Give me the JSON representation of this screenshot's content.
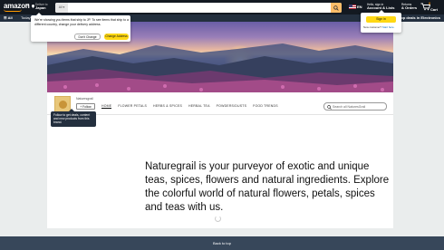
{
  "header": {
    "logo_text": "amazon",
    "logo_suffix": ".sg",
    "deliver_line1": "Deliver to",
    "deliver_line2": "Japan",
    "search_category": "All",
    "search_placeholder": "",
    "language": "EN",
    "account_line1": "Hello, sign in",
    "account_line2": "Account & Lists",
    "orders_line1": "Returns",
    "orders_line2": "& Orders",
    "cart_count": "0",
    "cart_label": "Cart"
  },
  "subnav": {
    "all_label": "All",
    "today_label": "Today's Deals",
    "promo_label": "Shop deals in Electronics"
  },
  "location_popover": {
    "message": "We're showing you items that ship to JP. To see items that ship to a different country, change your delivery address.",
    "dont_change": "Don't Change",
    "change_address": "Change Address"
  },
  "signin_popover": {
    "sign_in": "Sign in",
    "new_customer": "New customer?",
    "start_here": "Start here."
  },
  "store": {
    "brand_name": "Naturesgrail",
    "follow_label": "+ Follow",
    "nav_tabs": [
      {
        "label": "HOME"
      },
      {
        "label": "FLOWER PETALS"
      },
      {
        "label": "HERBS & SPICES"
      },
      {
        "label": "HERBAL TEA"
      },
      {
        "label": "POWDERS/DUSTS"
      },
      {
        "label": "FOOD TRENDS"
      }
    ],
    "search_placeholder": "Search all NaturesGrail",
    "follow_tooltip": [
      "Follow to get deals, content",
      "and new products from this",
      "brand."
    ],
    "headline": "Naturegrail is your purveyor of exotic and unique teas, spices, flowers and natural ingredients. Explore the colorful world of natural flowers, petals, spices and teas with us."
  },
  "footer": {
    "back_to_top": "Back to top"
  },
  "colors": {
    "nav_dark": "#131921",
    "nav_sub": "#232f3e",
    "accent_orange": "#febd69",
    "button_yellow": "#ffd814",
    "back_to_top": "#37475a"
  }
}
